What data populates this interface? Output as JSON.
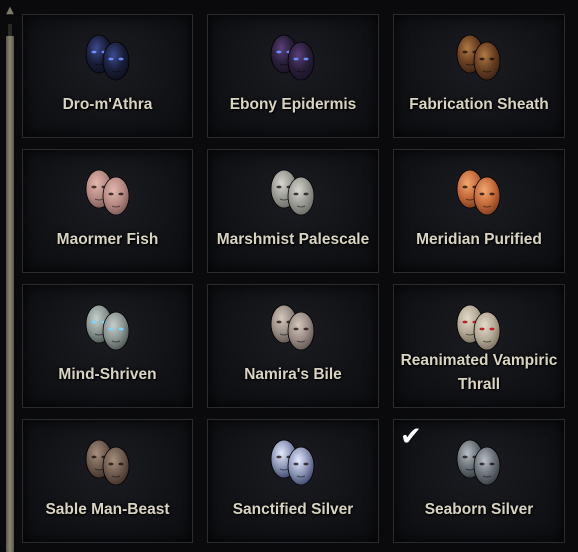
{
  "scrollbar": {
    "up_glyph": "▲"
  },
  "tiles": [
    {
      "label": "Dro-m'Athra",
      "icon": "dro-m-athra-skin-icon",
      "colors": [
        "#1a1f3a",
        "#3b4a8c",
        "#0d0f1c"
      ]
    },
    {
      "label": "Ebony Epidermis",
      "icon": "ebony-epidermis-skin-icon",
      "colors": [
        "#2a1f3a",
        "#5a3f7a",
        "#1a1224"
      ]
    },
    {
      "label": "Fabrication Sheath",
      "icon": "fabrication-sheath-skin-icon",
      "colors": [
        "#6a3f22",
        "#b07a44",
        "#3a2414"
      ]
    },
    {
      "label": "Maormer Fish",
      "icon": "maormer-fish-skin-icon",
      "colors": [
        "#b78a84",
        "#e1b8ae",
        "#7a5a56"
      ]
    },
    {
      "label": "Marshmist Palescale",
      "icon": "marshmist-palescale-skin-icon",
      "colors": [
        "#9a9a94",
        "#d8d6cc",
        "#6a6a66"
      ]
    },
    {
      "label": "Meridian Purified",
      "icon": "meridian-purified-skin-icon",
      "colors": [
        "#c46a3a",
        "#f2a870",
        "#7a3c1e"
      ]
    },
    {
      "label": "Mind-Shriven",
      "icon": "mind-shriven-skin-icon",
      "colors": [
        "#8a9490",
        "#c4d0cc",
        "#4a5452"
      ]
    },
    {
      "label": "Namira's Bile",
      "icon": "namiras-bile-skin-icon",
      "colors": [
        "#9a8e86",
        "#d4c8bc",
        "#5e544e"
      ]
    },
    {
      "label": "Reanimated Vampiric Thrall",
      "icon": "reanimated-vampiric-thrall-skin-icon",
      "colors": [
        "#b4aa98",
        "#e2dac8",
        "#7a6e5c"
      ]
    },
    {
      "label": "Sable Man-Beast",
      "icon": "sable-man-beast-skin-icon",
      "colors": [
        "#6e5a4e",
        "#a6907c",
        "#3e3028"
      ]
    },
    {
      "label": "Sanctified Silver",
      "icon": "sanctified-silver-skin-icon",
      "colors": [
        "#8a94b4",
        "#e4eaff",
        "#3a4468"
      ]
    },
    {
      "label": "Seaborn Silver",
      "icon": "seaborn-silver-skin-icon",
      "colors": [
        "#6a7278",
        "#b8c0c6",
        "#363c40"
      ]
    }
  ],
  "selected_tile": 11,
  "check_glyph": "✔"
}
